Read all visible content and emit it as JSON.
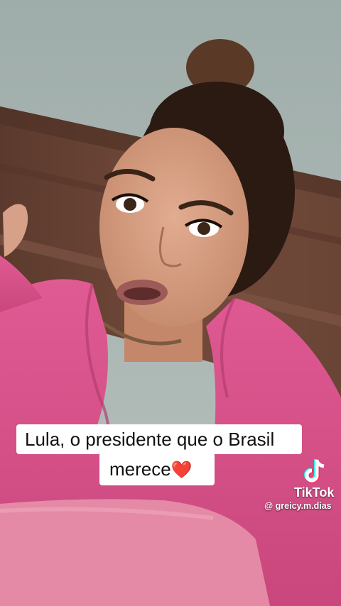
{
  "caption": {
    "line1": "Lula, o presidente que o Brasil",
    "line2": "merece",
    "emoji": "❤️"
  },
  "watermark": {
    "brand": "TikTok",
    "handle": "@ greicy.m.dias",
    "icon": "tiktok-logo-icon"
  },
  "colors": {
    "wall": "#a9b5b0",
    "headboard": "#6a4536",
    "robe": "#d64e86",
    "blanket": "#e48aa6",
    "caption_bg": "#ffffff",
    "heart": "#e01c2a"
  }
}
